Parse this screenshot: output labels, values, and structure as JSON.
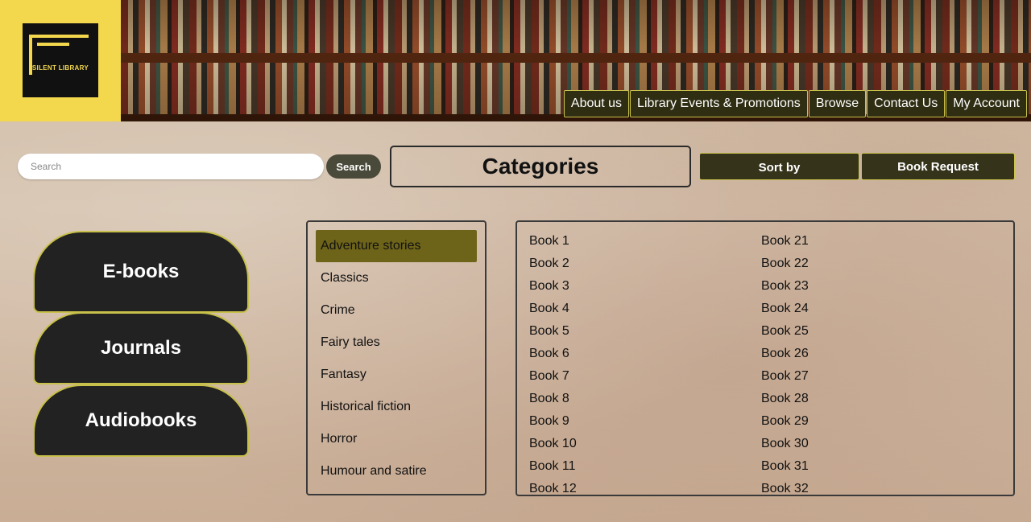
{
  "logo": {
    "text": "SILENT LIBRARY"
  },
  "nav": [
    "About us",
    "Library Events & Promotions",
    "Browse",
    "Contact Us",
    "My Account"
  ],
  "search": {
    "placeholder": "Search",
    "button": "Search"
  },
  "categories_title": "Categories",
  "sort_label": "Sort by",
  "request_label": "Book Request",
  "formats": [
    "E-books",
    "Journals",
    "Audiobooks"
  ],
  "categories": [
    "Adventure stories",
    "Classics",
    "Crime",
    "Fairy tales",
    "Fantasy",
    "Historical fiction",
    "Horror",
    "Humour and satire"
  ],
  "books_col1": [
    "Book 1",
    "Book 2",
    "Book 3",
    "Book 4",
    "Book 5",
    "Book 6",
    "Book 7",
    "Book 8",
    "Book 9",
    "Book 10",
    "Book 11",
    "Book 12"
  ],
  "books_col2": [
    "Book 21",
    "Book 22",
    "Book 23",
    "Book 24",
    "Book 25",
    "Book 26",
    "Book 27",
    "Book 28",
    "Book 29",
    "Book 30",
    "Book 31",
    "Book 32"
  ],
  "colors": {
    "accent": "#f3d84e",
    "button_dark": "#2f2d12",
    "selected_category": "#6e6419"
  }
}
